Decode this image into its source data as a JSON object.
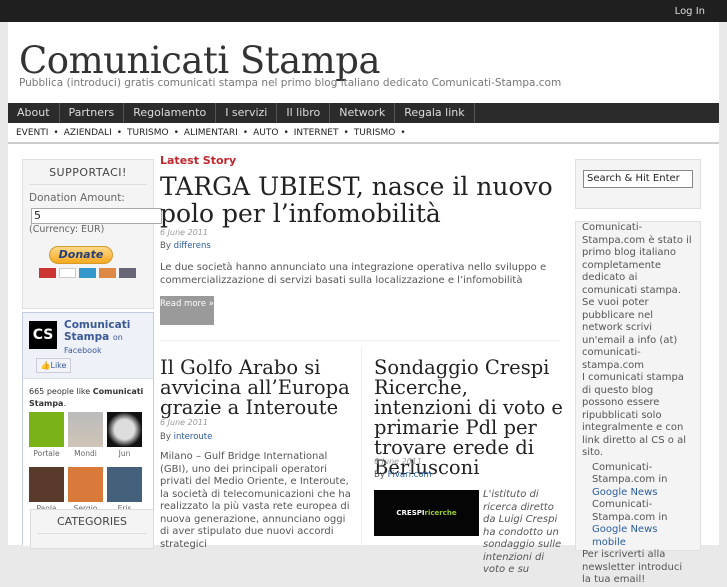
{
  "topbar": {
    "login": "Log In"
  },
  "header": {
    "title": "Comunicati Stampa",
    "tagline": "Pubblica (introduci) gratis comunicati stampa nel primo blog italiano dedicato Comunicati-Stampa.com"
  },
  "nav": [
    "About",
    "Partners",
    "Regolamento",
    "I servizi",
    "Il libro",
    "Network",
    "Regala link"
  ],
  "subnav": [
    "EVENTI",
    "AZIENDALI",
    "TURISMO",
    "ALIMENTARI",
    "AUTO",
    "INTERNET",
    "TURISMO"
  ],
  "support": {
    "title": "SUPPORTACI!",
    "amount_label": "Donation Amount:",
    "amount_value": "5",
    "currency": "(Currency: EUR)",
    "donate": "Donate"
  },
  "facebook": {
    "logo": "CS",
    "name": "Comunicati Stampa",
    "on": "on",
    "facebook": "Facebook",
    "like": "Like",
    "count_prefix": "665 people like ",
    "count_page": "Comunicati Stampa",
    "fans": [
      "Portale",
      "Mondi",
      "Jun",
      "Paola",
      "Sergio",
      "Eris"
    ]
  },
  "categories": {
    "title": "CATEGORIES"
  },
  "latest": {
    "label": "Latest Story",
    "title": "TARGA UBIEST, nasce il nuovo polo per l’infomobilità",
    "date": "6 June 2011",
    "by": "By",
    "author": "differens",
    "excerpt": "Le due società hanno annunciato una integrazione operativa nello sviluppo e commercializzazione di servizi basati sulla localizzazione e l’infomobilità",
    "read_more": "Read more »"
  },
  "post2": {
    "title": "Il Golfo Arabo si avvicina all’Europa grazie a Interoute",
    "date": "6 June 2011",
    "by": "By",
    "author": "interoute",
    "text": "Milano – Gulf Bridge International (GBI), uno dei principali operatori privati del Medio Oriente, e Interoute, la società di telecomunicazioni che ha realizzato la più vasta rete europea di nuova generazione, annunciano oggi di aver stipulato due nuovi accordi strategici"
  },
  "post3": {
    "title": "Sondaggio Crespi Ricerche, intenzioni di voto e primarie Pdl per trovare erede di Berlusconi",
    "date": "6 June 2011",
    "by": "By",
    "author": "Pivari.com",
    "image_text": "CRESPI",
    "image_text2": "ricerche",
    "text": "L'istituto di ricerca diretto da Luigi Crespi ha condotto un sondaggio sulle intenzioni di voto e su"
  },
  "search": {
    "placeholder": "Search & Hit Enter"
  },
  "about": {
    "p1": "Comunicati-Stampa.com è stato il primo blog italiano completamente dedicato ai comunicati stampa.",
    "p2": "Se vuoi poter pubblicare nel network scrivi un'email a info (at) comunicati-stampa.com",
    "p3": "I comunicati stampa di questo blog possono essere ripubblicati solo integralmente e con link diretto al CS o al sito.",
    "gn1": "Comunicati-Stampa.com in",
    "gn1_link": "Google News",
    "gn2": "Comunicati-Stampa.com in",
    "gn2_link": "Google News mobile",
    "p4": "Per iscriverti alla newsletter introduci la tua email!"
  }
}
